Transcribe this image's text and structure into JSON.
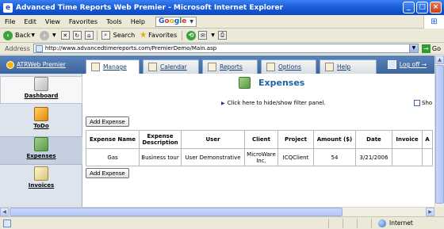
{
  "window": {
    "title": "Advanced Time Reports Web Premier - Microsoft Internet Explorer",
    "buttons": {
      "minimize": "_",
      "maximize": "□",
      "close": "×"
    }
  },
  "menu": {
    "items": [
      "File",
      "Edit",
      "View",
      "Favorites",
      "Tools",
      "Help"
    ],
    "google_letters": [
      "G",
      "o",
      "o",
      "g",
      "l",
      "e"
    ]
  },
  "toolbar": {
    "back": "Back",
    "search": "Search",
    "favorites": "Favorites"
  },
  "address": {
    "label": "Address",
    "url": "http://www.advancedtimereports.com/PremierDemo/Main.asp",
    "go": "Go"
  },
  "appnav": {
    "brand": "ATRWeb Premier",
    "tabs": [
      {
        "label": "Manage",
        "icon": "manage-icon"
      },
      {
        "label": "Calendar",
        "icon": "calendar-icon"
      },
      {
        "label": "Reports",
        "icon": "reports-icon"
      },
      {
        "label": "Options",
        "icon": "options-icon"
      },
      {
        "label": "Help",
        "icon": "help-icon"
      }
    ],
    "logoff": "Log off →"
  },
  "sidebar": {
    "items": [
      {
        "label": "Dashboard",
        "icon": "dashboard-icon"
      },
      {
        "label": "ToDo",
        "icon": "todo-icon"
      },
      {
        "label": "Expenses",
        "icon": "expenses-icon"
      },
      {
        "label": "Invoices",
        "icon": "invoices-icon"
      }
    ]
  },
  "main": {
    "title": "Expenses",
    "filter_link": "Click here to hide/show filter panel.",
    "show_label": "Sho",
    "add_button": "Add Expense",
    "table": {
      "headers": [
        "Expense Name",
        "Expense Description",
        "User",
        "Client",
        "Project",
        "Amount ($)",
        "Date",
        "Invoice",
        "A"
      ],
      "rows": [
        [
          "Gas",
          "Business tour",
          "User Demonstrative",
          "MicroWare Inc.",
          "ICQClient",
          "54",
          "3/21/2006",
          "",
          ""
        ]
      ]
    }
  },
  "statusbar": {
    "zone": "Internet"
  }
}
